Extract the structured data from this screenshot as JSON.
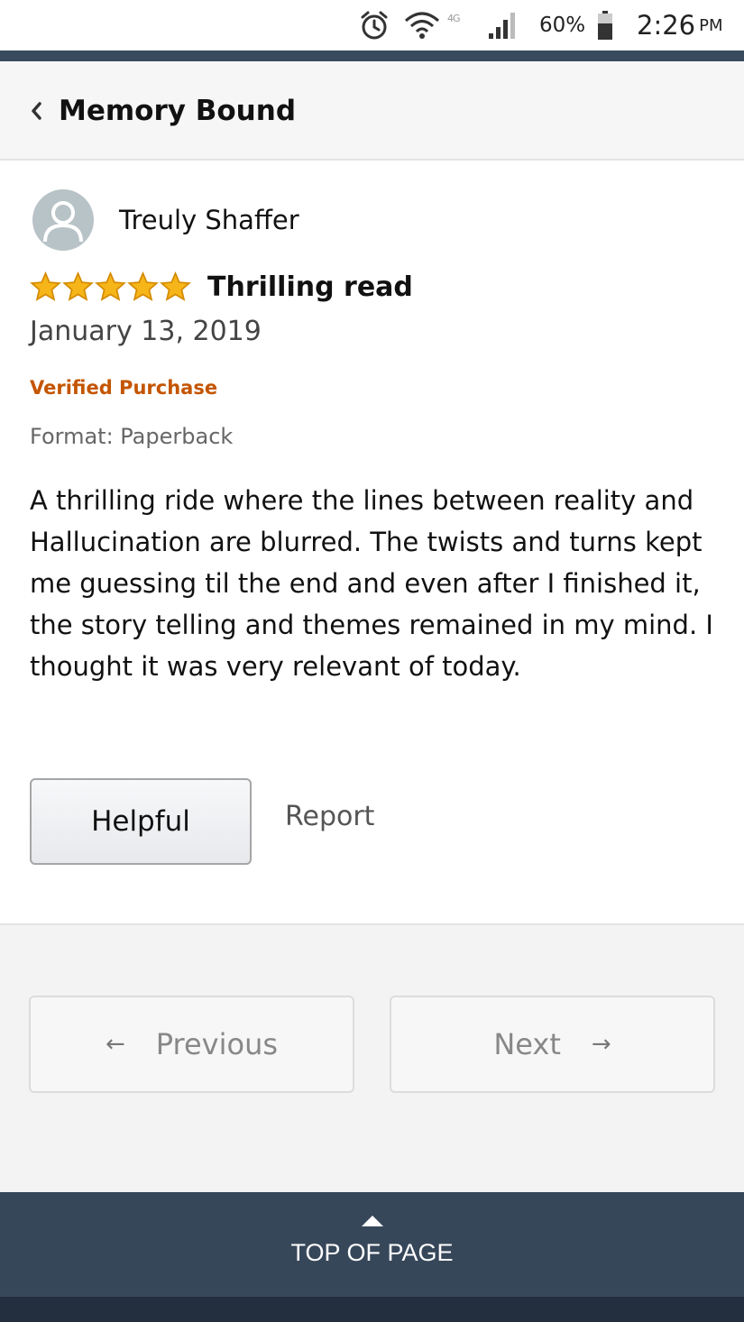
{
  "status_bar": {
    "network_label": "4G",
    "battery_percent": "60%",
    "time": "2:26",
    "ampm": "PM",
    "icons": [
      "alarm-icon",
      "wifi-icon",
      "signal-icon",
      "battery-icon"
    ]
  },
  "header": {
    "title": "Memory Bound",
    "back_icon": "chevron-left-icon"
  },
  "review": {
    "reviewer_name": "Treuly Shaffer",
    "rating": 5,
    "rating_max": 5,
    "title": "Thrilling read",
    "date": "January 13, 2019",
    "verified_label": "Verified Purchase",
    "format": "Format: Paperback",
    "body": "A thrilling ride where the lines between reality and Hallucination are blurred. The twists and turns kept me guessing til the end and even after I finished it, the story telling and themes remained in my mind. I thought it was very relevant of today.",
    "helpful_label": "Helpful",
    "report_label": "Report"
  },
  "pagination": {
    "prev_arrow": "←",
    "prev_label": "Previous",
    "next_label": "Next",
    "next_arrow": "→"
  },
  "footer": {
    "top_of_page_label": "TOP OF PAGE"
  },
  "colors": {
    "header_dark": "#37475a",
    "star": "#f0a500",
    "verified": "#c45500"
  }
}
